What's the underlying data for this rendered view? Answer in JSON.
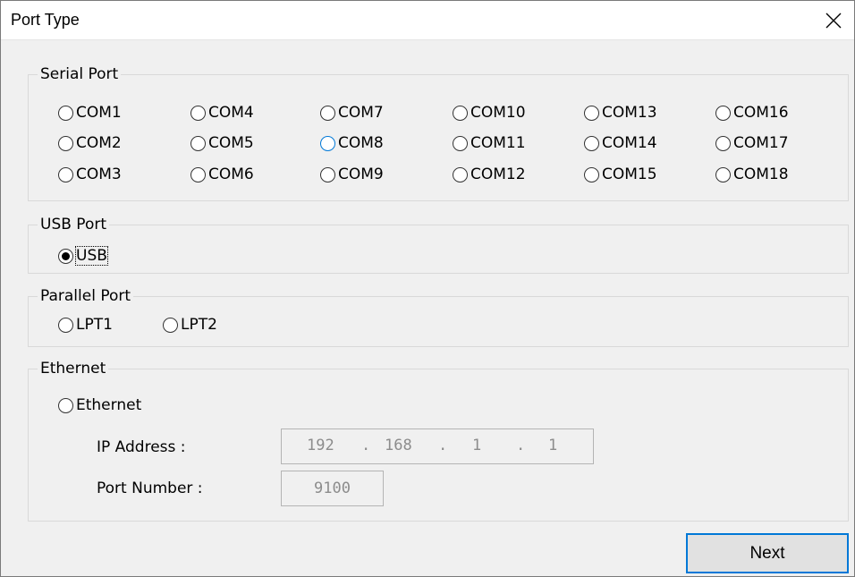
{
  "window": {
    "title": "Port Type"
  },
  "serial": {
    "label": "Serial Port",
    "ports": [
      "COM1",
      "COM2",
      "COM3",
      "COM4",
      "COM5",
      "COM6",
      "COM7",
      "COM8",
      "COM9",
      "COM10",
      "COM11",
      "COM12",
      "COM13",
      "COM14",
      "COM15",
      "COM16",
      "COM17",
      "COM18"
    ]
  },
  "usb": {
    "label": "USB Port",
    "option": "USB",
    "selected": true
  },
  "parallel": {
    "label": "Parallel Port",
    "options": [
      "LPT1",
      "LPT2"
    ]
  },
  "ethernet": {
    "label": "Ethernet",
    "option": "Ethernet",
    "ip_label": "IP Address :",
    "ip": [
      "192",
      "168",
      "1",
      "1"
    ],
    "ip_dot": ".",
    "port_label": "Port Number :",
    "port": "9100"
  },
  "buttons": {
    "next": "Next"
  },
  "colors": {
    "accent": "#0078d7",
    "background": "#f0f0f0",
    "disabled_text": "#8c8c8c"
  }
}
